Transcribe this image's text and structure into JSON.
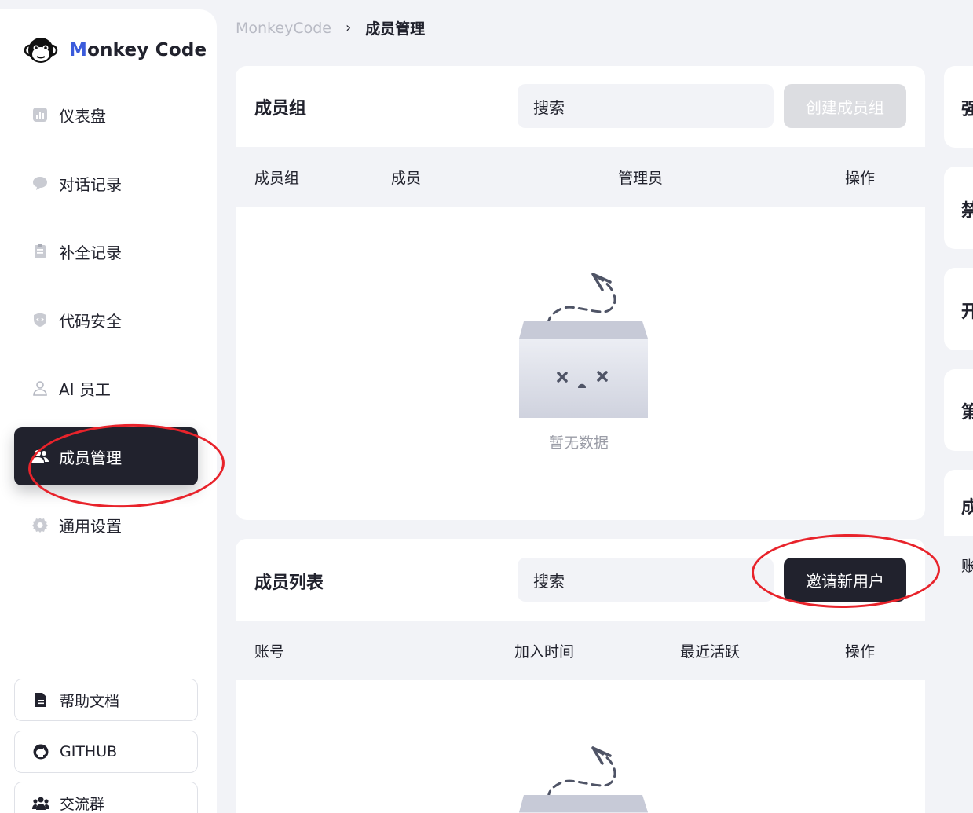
{
  "brand": {
    "first_letter": "M",
    "rest": "onkey Code"
  },
  "sidebar": {
    "items": [
      {
        "label": "仪表盘",
        "icon": "chart-icon"
      },
      {
        "label": "对话记录",
        "icon": "chat-icon"
      },
      {
        "label": "补全记录",
        "icon": "clipboard-icon"
      },
      {
        "label": "代码安全",
        "icon": "shield-code-icon"
      },
      {
        "label": "AI 员工",
        "icon": "user-icon"
      },
      {
        "label": "成员管理",
        "icon": "users-icon",
        "active": true
      },
      {
        "label": "通用设置",
        "icon": "gear-icon"
      }
    ],
    "footer": [
      {
        "label": "帮助文档",
        "icon": "document-icon"
      },
      {
        "label": "GITHUB",
        "icon": "github-icon"
      },
      {
        "label": "交流群",
        "icon": "group-icon"
      }
    ]
  },
  "breadcrumb": {
    "root": "MonkeyCode",
    "separator": "›",
    "current": "成员管理"
  },
  "groups_card": {
    "title": "成员组",
    "search_placeholder": "搜索",
    "create_button": "创建成员组",
    "columns": [
      "成员组",
      "成员",
      "管理员",
      "操作"
    ],
    "empty_text": "暂无数据"
  },
  "members_card": {
    "title": "成员列表",
    "search_placeholder": "搜索",
    "invite_button": "邀请新用户",
    "columns": [
      "账号",
      "加入时间",
      "最近活跃",
      "操作"
    ]
  },
  "right_panel": {
    "cards": [
      "强",
      "禁",
      "开",
      "第",
      "成"
    ],
    "row_text": "账"
  },
  "colors": {
    "accent": "#21222d",
    "brand_blue": "#3b5bdb",
    "annotation": "#e8232b",
    "page_bg": "#f2f3f7"
  }
}
